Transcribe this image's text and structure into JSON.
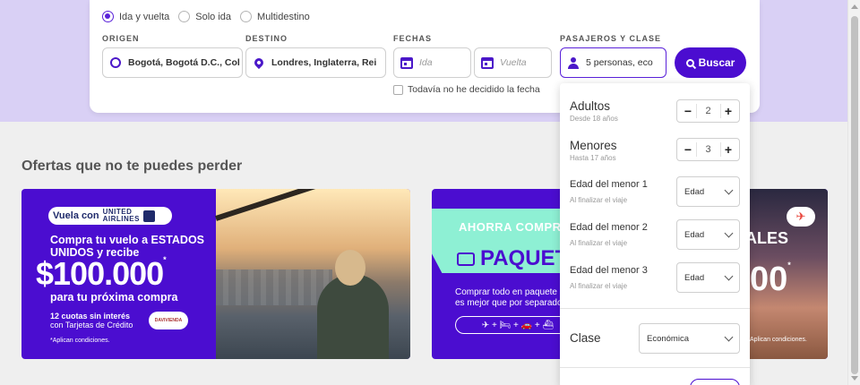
{
  "trip_types": [
    {
      "label": "Ida y vuelta",
      "checked": true
    },
    {
      "label": "Solo ida",
      "checked": false
    },
    {
      "label": "Multidestino",
      "checked": false
    }
  ],
  "search": {
    "origin_label": "ORIGEN",
    "origin_value": "Bogotá, Bogotá D.C., Col",
    "destination_label": "DESTINO",
    "destination_value": "Londres, Inglaterra, Rei",
    "dates_label": "FECHAS",
    "depart_placeholder": "Ida",
    "return_placeholder": "Vuelta",
    "passengers_label": "PASAJEROS Y CLASE",
    "passengers_value": "5 personas, eco",
    "flexible_date": "Todavía no he decidido la fecha",
    "search_button": "Buscar"
  },
  "offers": {
    "title": "Ofertas que no te puedes perder",
    "banner1": {
      "pill_prefix": "Vuela con",
      "airline_line1": "UNITED",
      "airline_line2": "AIRLINES",
      "headline": "Compra tu vuelo a ESTADOS UNIDOS y recibe",
      "amount": "$100.000",
      "amount_mark": "*",
      "subline": "para tu próxima compra",
      "cuotas_bold": "12 cuotas sin interés",
      "cuotas_rest": "con Tarjetas de Crédito",
      "bank": "DAVIVIENDA",
      "conditions": "*Aplican condiciones."
    },
    "banner2": {
      "top": "AHORRA COMPR",
      "pack": "PAQUETE",
      "text": "Comprar todo en paquete es mejor que por separado",
      "icons": "✈ + 🛏 + 🚗 + ⛴",
      "right_top": "ALES",
      "right_big": "00",
      "right_mark": "*",
      "conditions": "Aplican condiciones."
    }
  },
  "passengers_popup": {
    "adults_label": "Adultos",
    "adults_sub": "Desde 18 años",
    "adults_count": "2",
    "minors_label": "Menores",
    "minors_sub": "Hasta 17 años",
    "minors_count": "3",
    "minus": "−",
    "plus": "+",
    "minor_ages": [
      {
        "label": "Edad del menor 1",
        "sub": "Al finalizar el viaje",
        "value": "Edad"
      },
      {
        "label": "Edad del menor 2",
        "sub": "Al finalizar el viaje",
        "value": "Edad"
      },
      {
        "label": "Edad del menor 3",
        "sub": "Al finalizar el viaje",
        "value": "Edad"
      }
    ],
    "class_label": "Clase",
    "class_value": "Económica"
  },
  "colors": {
    "brand_purple": "#4b0dd0",
    "hero_lavender": "#d9d0f5",
    "mint": "#8ef0d4"
  }
}
